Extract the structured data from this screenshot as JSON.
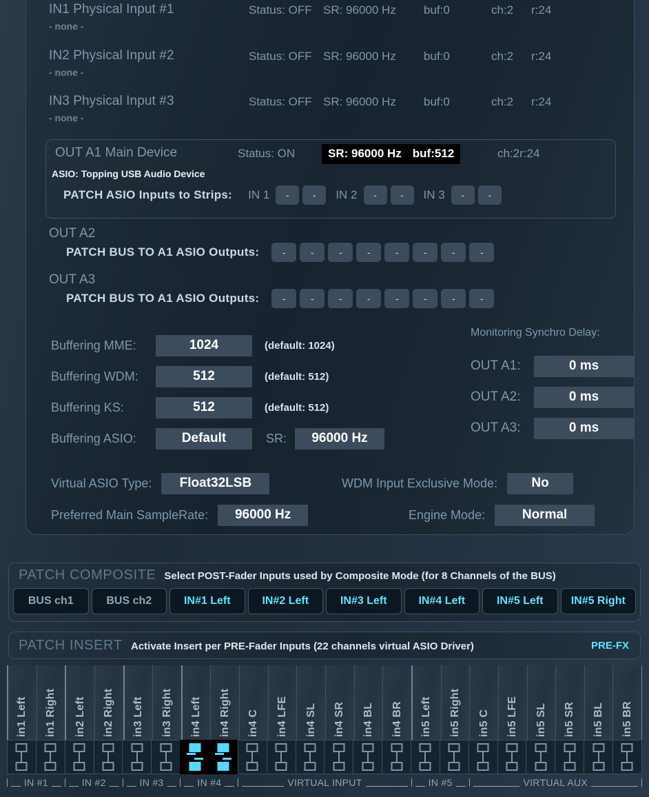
{
  "devices": [
    {
      "name": "IN1 Physical Input #1",
      "sub": "- none -",
      "status": "Status: OFF",
      "sr": "SR: 96000 Hz",
      "buf": "buf:0",
      "ch": "ch:2",
      "r": "r:24"
    },
    {
      "name": "IN2 Physical Input #2",
      "sub": "- none -",
      "status": "Status: OFF",
      "sr": "SR: 96000 Hz",
      "buf": "buf:0",
      "ch": "ch:2",
      "r": "r:24"
    },
    {
      "name": "IN3 Physical Input #3",
      "sub": "- none -",
      "status": "Status: OFF",
      "sr": "SR: 96000 Hz",
      "buf": "buf:0",
      "ch": "ch:2",
      "r": "r:24"
    }
  ],
  "out_a1": {
    "name": "OUT A1 Main Device",
    "status": "Status: ON",
    "highlight_sr": "SR: 96000 Hz",
    "highlight_buf": "buf:512",
    "ch": "ch:2",
    "r": "r:24",
    "driver": "ASIO: Topping USB Audio Device",
    "patch_title": "PATCH ASIO Inputs to Strips:",
    "groups": [
      {
        "label": "IN 1",
        "buttons": [
          "-",
          "-"
        ]
      },
      {
        "label": "IN 2",
        "buttons": [
          "-",
          "-"
        ]
      },
      {
        "label": "IN 3",
        "buttons": [
          "-",
          "-"
        ]
      }
    ]
  },
  "out_a2": {
    "name": "OUT A2",
    "patch_title": "PATCH BUS TO A1 ASIO Outputs:",
    "buttons": [
      "-",
      "-",
      "-",
      "-",
      "-",
      "-",
      "-",
      "-"
    ]
  },
  "out_a3": {
    "name": "OUT A3",
    "patch_title": "PATCH BUS TO A1 ASIO Outputs:",
    "buttons": [
      "-",
      "-",
      "-",
      "-",
      "-",
      "-",
      "-",
      "-"
    ]
  },
  "buffering": [
    {
      "label": "Buffering MME:",
      "value": "1024",
      "default": "(default: 1024)"
    },
    {
      "label": "Buffering WDM:",
      "value": "512",
      "default": "(default: 512)"
    },
    {
      "label": "Buffering KS:",
      "value": "512",
      "default": "(default: 512)"
    }
  ],
  "buffering_asio": {
    "label": "Buffering ASIO:",
    "value": "Default",
    "sr_label": "SR:",
    "sr_value": "96000 Hz"
  },
  "monitoring": {
    "title": "Monitoring Synchro Delay:",
    "rows": [
      {
        "label": "OUT A1:",
        "value": "0 ms"
      },
      {
        "label": "OUT A2:",
        "value": "0 ms"
      },
      {
        "label": "OUT A3:",
        "value": "0 ms"
      }
    ]
  },
  "lower_settings": {
    "virtual_asio_label": "Virtual ASIO Type:",
    "virtual_asio_value": "Float32LSB",
    "wdm_label": "WDM Input Exclusive Mode:",
    "wdm_value": "No",
    "samplerate_label": "Preferred Main SampleRate:",
    "samplerate_value": "96000 Hz",
    "engine_label": "Engine Mode:",
    "engine_value": "Normal"
  },
  "patch_composite": {
    "title": "PATCH COMPOSITE",
    "subtitle": "Select POST-Fader Inputs used by Composite Mode (for 8 Channels of the BUS)",
    "buttons": [
      {
        "label": "BUS ch1",
        "active": false
      },
      {
        "label": "BUS ch2",
        "active": false
      },
      {
        "label": "IN#1 Left",
        "active": true
      },
      {
        "label": "IN#2 Left",
        "active": true
      },
      {
        "label": "IN#3 Left",
        "active": true
      },
      {
        "label": "IN#4 Left",
        "active": true
      },
      {
        "label": "IN#5 Left",
        "active": true
      },
      {
        "label": "IN#5 Right",
        "active": true
      }
    ]
  },
  "patch_insert": {
    "title": "PATCH INSERT",
    "subtitle": "Activate Insert per PRE-Fader Inputs (22 channels virtual ASIO Driver)",
    "prefx": "PRE-FX",
    "channels": [
      {
        "label": "in1 Left",
        "on": false,
        "group_start": true
      },
      {
        "label": "in1 Right",
        "on": false,
        "group_start": false
      },
      {
        "label": "in2 Left",
        "on": false,
        "group_start": true
      },
      {
        "label": "in2 Right",
        "on": false,
        "group_start": false
      },
      {
        "label": "in3 Left",
        "on": false,
        "group_start": true
      },
      {
        "label": "in3 Right",
        "on": false,
        "group_start": false
      },
      {
        "label": "in4 Left",
        "on": true,
        "group_start": true
      },
      {
        "label": "in4 Right",
        "on": true,
        "group_start": false
      },
      {
        "label": "in4 C",
        "on": false,
        "group_start": false
      },
      {
        "label": "in4 LFE",
        "on": false,
        "group_start": false
      },
      {
        "label": "in4 SL",
        "on": false,
        "group_start": false
      },
      {
        "label": "in4 SR",
        "on": false,
        "group_start": false
      },
      {
        "label": "in4 BL",
        "on": false,
        "group_start": false
      },
      {
        "label": "in4 BR",
        "on": false,
        "group_start": false
      },
      {
        "label": "in5 Left",
        "on": false,
        "group_start": true
      },
      {
        "label": "in5 Right",
        "on": false,
        "group_start": false
      },
      {
        "label": "in5 C",
        "on": false,
        "group_start": false
      },
      {
        "label": "in5 LFE",
        "on": false,
        "group_start": false
      },
      {
        "label": "in5 SL",
        "on": false,
        "group_start": false
      },
      {
        "label": "in5 SR",
        "on": false,
        "group_start": false
      },
      {
        "label": "in5 BL",
        "on": false,
        "group_start": false
      },
      {
        "label": "in5 BR",
        "on": false,
        "group_start": false
      }
    ],
    "footer_groups": [
      "IN #1",
      "IN #2",
      "IN #3",
      "IN #4",
      "VIRTUAL INPUT",
      "IN #5",
      "VIRTUAL AUX"
    ]
  },
  "colors": {
    "accent_cyan": "#5fe3ff",
    "label_blue": "#7e98ad",
    "value_box": "#3c4c5c",
    "panel_bg": "#1a2733"
  }
}
